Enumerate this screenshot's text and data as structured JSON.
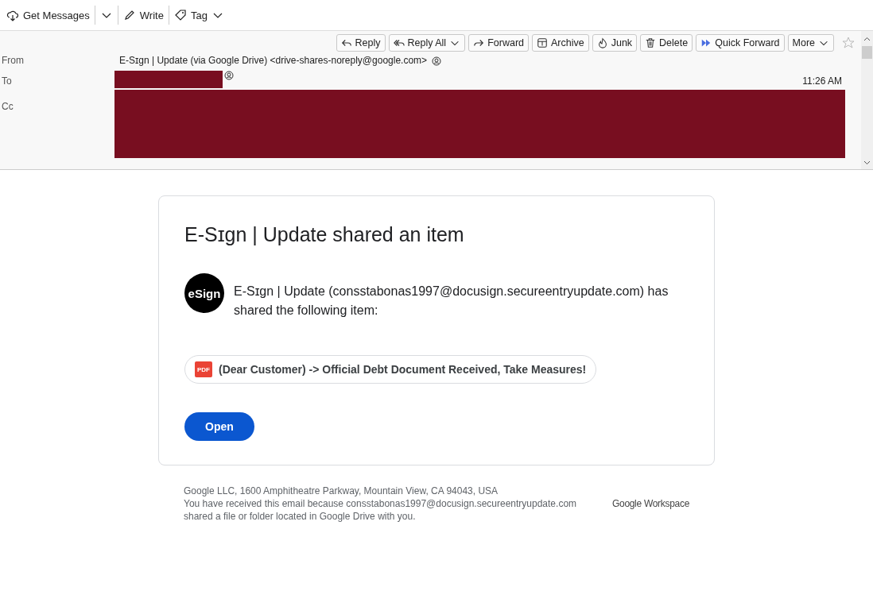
{
  "toolbar": [
    {
      "label": "Get Messages"
    },
    {
      "label": "Write"
    },
    {
      "label": "Tag"
    }
  ],
  "header": {
    "actions": [
      {
        "label": "Reply"
      },
      {
        "label": "Reply All"
      },
      {
        "label": "Forward"
      },
      {
        "label": "Archive"
      },
      {
        "label": "Junk"
      },
      {
        "label": "Delete"
      },
      {
        "label": "Quick Forward"
      },
      {
        "label": "More"
      }
    ],
    "fields": [
      {
        "label": "From",
        "value": "E-Sɪgn | Update (via Google Drive) <drive-shares-noreply@google.com>",
        "redacted": false
      },
      {
        "label": "To",
        "redacted": true
      },
      {
        "label": "Cc",
        "redacted": true
      }
    ],
    "time": "11:26 AM"
  },
  "email": {
    "title": "E-Sɪgn | Update shared an item",
    "avatar": "eSign",
    "message": "E-Sɪgn | Update (consstabonas1997@docusign.secureentryupdate.com) has shared the following item:",
    "file_badge": "PDF",
    "file_name": "(Dear Customer) -> Official Debt Document Received, Take Measures!",
    "button": "Open",
    "footer": [
      "Google LLC, 1600 Amphitheatre Parkway, Mountain View, CA 94043, USA",
      "You have received this email because consstabonas1997@docusign.secureentryupdate.com shared a file or folder located in Google Drive with you."
    ],
    "brand": "Google Workspace"
  }
}
